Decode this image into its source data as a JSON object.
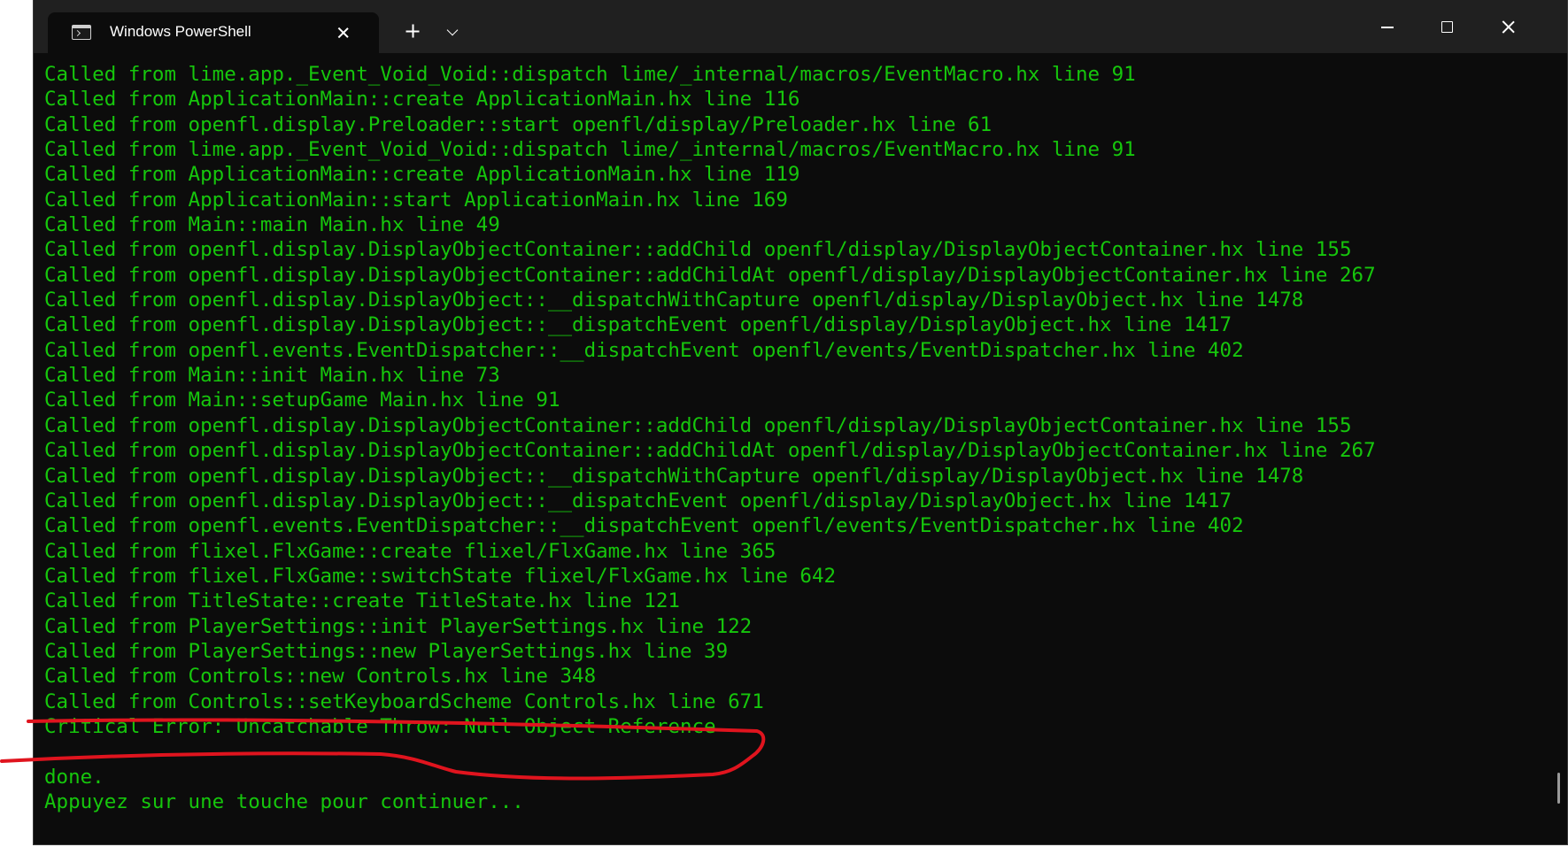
{
  "window": {
    "tab_title": "Windows PowerShell",
    "tab_icon": "powershell-terminal-icon",
    "new_tab_icon": "plus-icon",
    "dropdown_icon": "chevron-down-icon",
    "minimize_icon": "minimize-icon",
    "maximize_icon": "maximize-icon",
    "close_icon": "close-icon"
  },
  "colors": {
    "terminal_bg": "#0c0c0c",
    "text": "#16c60c",
    "titlebar": "#202020",
    "annotation": "#e0141e"
  },
  "console": {
    "lines": [
      "Called from lime.app._Event_Void_Void::dispatch lime/_internal/macros/EventMacro.hx line 91",
      "Called from ApplicationMain::create ApplicationMain.hx line 116",
      "Called from openfl.display.Preloader::start openfl/display/Preloader.hx line 61",
      "Called from lime.app._Event_Void_Void::dispatch lime/_internal/macros/EventMacro.hx line 91",
      "Called from ApplicationMain::create ApplicationMain.hx line 119",
      "Called from ApplicationMain::start ApplicationMain.hx line 169",
      "Called from Main::main Main.hx line 49",
      "Called from openfl.display.DisplayObjectContainer::addChild openfl/display/DisplayObjectContainer.hx line 155",
      "Called from openfl.display.DisplayObjectContainer::addChildAt openfl/display/DisplayObjectContainer.hx line 267",
      "Called from openfl.display.DisplayObject::__dispatchWithCapture openfl/display/DisplayObject.hx line 1478",
      "Called from openfl.display.DisplayObject::__dispatchEvent openfl/display/DisplayObject.hx line 1417",
      "Called from openfl.events.EventDispatcher::__dispatchEvent openfl/events/EventDispatcher.hx line 402",
      "Called from Main::init Main.hx line 73",
      "Called from Main::setupGame Main.hx line 91",
      "Called from openfl.display.DisplayObjectContainer::addChild openfl/display/DisplayObjectContainer.hx line 155",
      "Called from openfl.display.DisplayObjectContainer::addChildAt openfl/display/DisplayObjectContainer.hx line 267",
      "Called from openfl.display.DisplayObject::__dispatchWithCapture openfl/display/DisplayObject.hx line 1478",
      "Called from openfl.display.DisplayObject::__dispatchEvent openfl/display/DisplayObject.hx line 1417",
      "Called from openfl.events.EventDispatcher::__dispatchEvent openfl/events/EventDispatcher.hx line 402",
      "Called from flixel.FlxGame::create flixel/FlxGame.hx line 365",
      "Called from flixel.FlxGame::switchState flixel/FlxGame.hx line 642",
      "Called from TitleState::create TitleState.hx line 121",
      "Called from PlayerSettings::init PlayerSettings.hx line 122",
      "Called from PlayerSettings::new PlayerSettings.hx line 39",
      "Called from Controls::new Controls.hx line 348",
      "Called from Controls::setKeyboardScheme Controls.hx line 671",
      "Critical Error: Uncatchable Throw: Null Object Reference",
      "",
      "done.",
      "Appuyez sur une touche pour continuer..."
    ]
  }
}
